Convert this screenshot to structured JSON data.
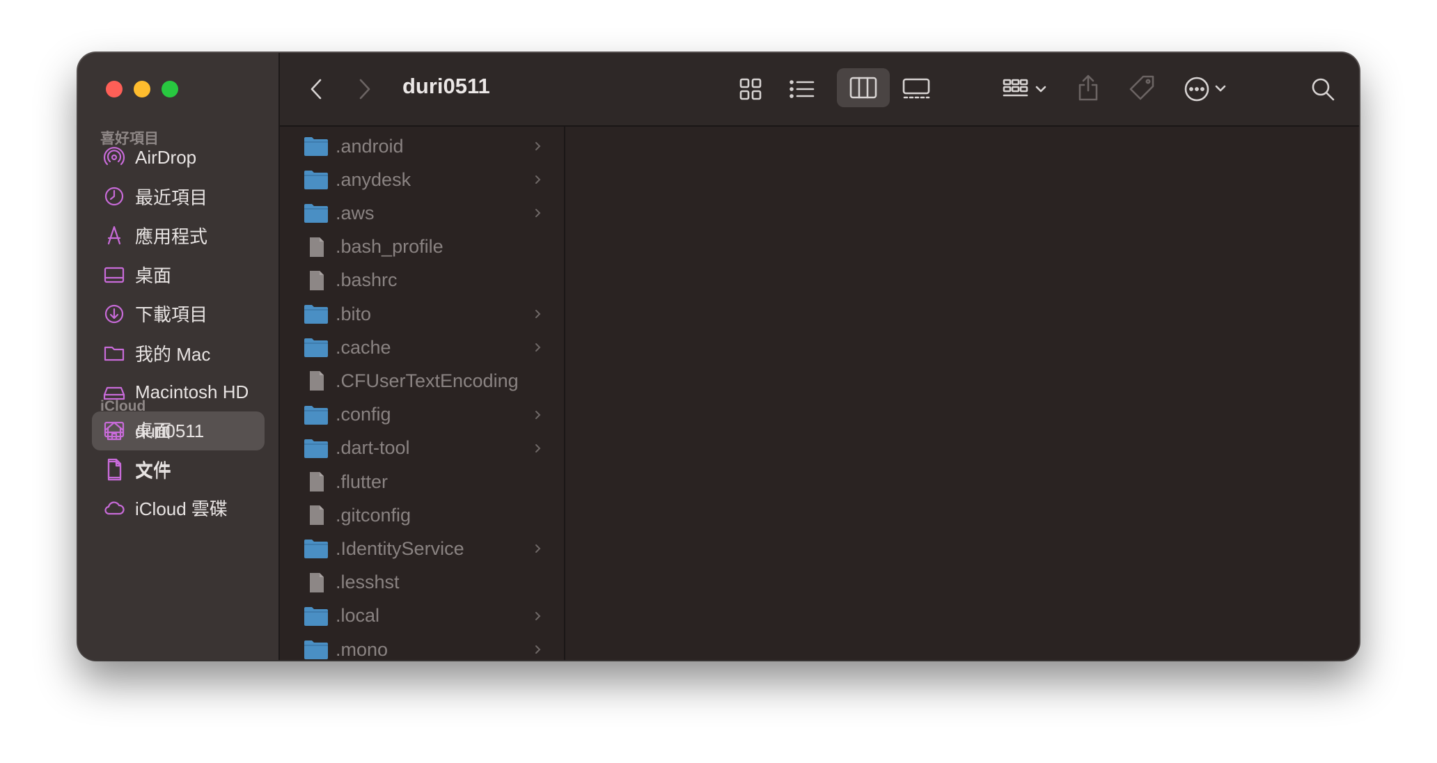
{
  "window": {
    "title": "duri0511"
  },
  "sidebar": {
    "favorites_label": "喜好項目",
    "favorites": [
      {
        "label": "AirDrop",
        "icon": "airdrop-icon"
      },
      {
        "label": "最近項目",
        "icon": "clock-icon"
      },
      {
        "label": "應用程式",
        "icon": "applications-icon"
      },
      {
        "label": "桌面",
        "icon": "desktop-icon"
      },
      {
        "label": "下載項目",
        "icon": "download-icon"
      },
      {
        "label": "我的 Mac",
        "icon": "folder-icon"
      },
      {
        "label": "Macintosh HD",
        "icon": "drive-icon"
      },
      {
        "label": "duri0511",
        "icon": "home-icon",
        "active": true
      },
      {
        "label": "文件",
        "icon": "document-icon"
      }
    ],
    "icloud_label": "iCloud",
    "icloud": [
      {
        "label": "桌面",
        "icon": "desktop-icon"
      },
      {
        "label": "文件",
        "icon": "document-icon"
      },
      {
        "label": "iCloud 雲碟",
        "icon": "cloud-icon"
      }
    ]
  },
  "files": [
    {
      "name": ".android",
      "type": "folder"
    },
    {
      "name": ".anydesk",
      "type": "folder"
    },
    {
      "name": ".aws",
      "type": "folder"
    },
    {
      "name": ".bash_profile",
      "type": "file"
    },
    {
      "name": ".bashrc",
      "type": "file"
    },
    {
      "name": ".bito",
      "type": "folder"
    },
    {
      "name": ".cache",
      "type": "folder"
    },
    {
      "name": ".CFUserTextEncoding",
      "type": "file"
    },
    {
      "name": ".config",
      "type": "folder"
    },
    {
      "name": ".dart-tool",
      "type": "folder"
    },
    {
      "name": ".flutter",
      "type": "file"
    },
    {
      "name": ".gitconfig",
      "type": "file"
    },
    {
      "name": ".IdentityService",
      "type": "folder"
    },
    {
      "name": ".lesshst",
      "type": "file"
    },
    {
      "name": ".local",
      "type": "folder"
    },
    {
      "name": ".mono",
      "type": "folder"
    }
  ],
  "colors": {
    "accent": "#c86bd9",
    "folder": "#4a8fc4",
    "close": "#fe5f57",
    "minimize": "#febc2e",
    "maximize": "#28c840"
  }
}
